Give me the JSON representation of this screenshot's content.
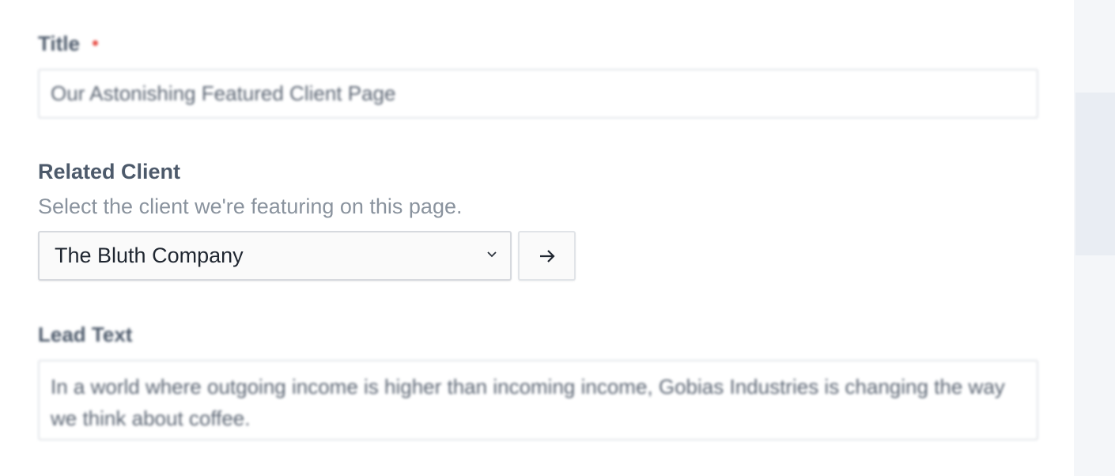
{
  "form": {
    "title_field": {
      "label": "Title",
      "value": "Our Astonishing Featured Client Page",
      "required": true
    },
    "related_client": {
      "label": "Related Client",
      "help_text": "Select the client we're featuring on this page.",
      "selected_value": "The Bluth Company",
      "go_icon": "arrow-right-icon"
    },
    "lead_text_field": {
      "label": "Lead Text",
      "value": "In a world where outgoing income is higher than incoming income, Gobias Industries is changing the way we think about coffee."
    }
  },
  "colors": {
    "label": "#4d5a6b",
    "help_text": "#8a939e",
    "required": "#e8524a",
    "border": "#e3e6ea",
    "side_panel": "#f4f6f9"
  }
}
